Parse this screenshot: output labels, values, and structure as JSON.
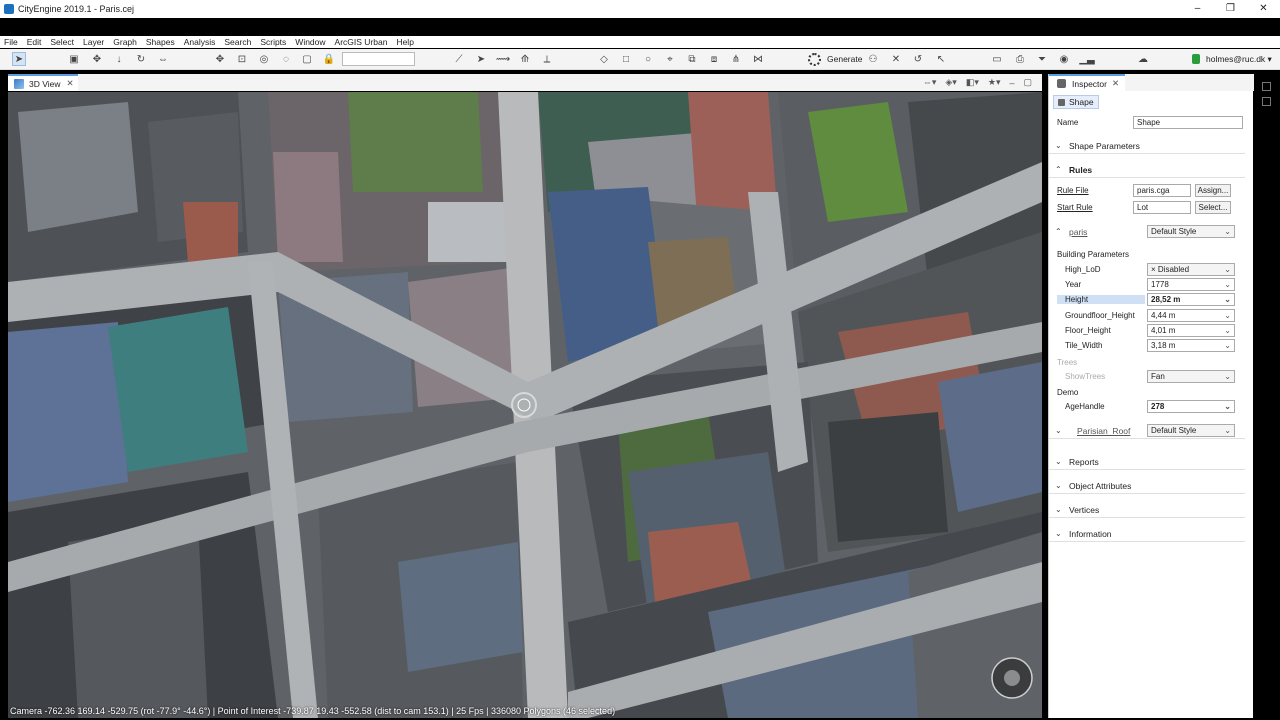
{
  "window": {
    "title": "CityEngine 2019.1 - Paris.cej",
    "controls": [
      "–",
      "❐",
      "✕"
    ]
  },
  "menu": [
    "File",
    "Edit",
    "Select",
    "Layer",
    "Graph",
    "Shapes",
    "Analysis",
    "Search",
    "Scripts",
    "Window",
    "ArcGIS Urban",
    "Help"
  ],
  "toolbar": {
    "generate_label": "Generate",
    "user_label": "holmes@ruc.dk ▾"
  },
  "view": {
    "tab_label": "3D View",
    "status": "Camera -762.36 169.14 -529.75 (rot -77.9° -44.6°) | Point of Interest -739.87 19.43 -552.58 (dist to cam 153.1) | 25 Fps | 336080 Polygons (46 selected)"
  },
  "inspector": {
    "tab_label": "Inspector",
    "shape_button": "Shape",
    "name_label": "Name",
    "name_value": "Shape",
    "shape_parameters": "Shape Parameters",
    "rules": "Rules",
    "rule_file_label": "Rule File",
    "rule_file_value": "paris.cga",
    "assign_button": "Assign...",
    "start_rule_label": "Start Rule",
    "start_rule_value": "Lot",
    "select_button": "Select...",
    "paris_label": "paris",
    "paris_style": "Default Style",
    "building_parameters": "Building Parameters",
    "params": [
      {
        "label": "High_LoD",
        "value": "× Disabled"
      },
      {
        "label": "Year",
        "value": "1778"
      },
      {
        "label": "Height",
        "value": "28,52 m"
      },
      {
        "label": "Groundfloor_Height",
        "value": "4,44 m"
      },
      {
        "label": "Floor_Height",
        "value": "4,01 m"
      },
      {
        "label": "Tile_Width",
        "value": "3,18 m"
      }
    ],
    "trees_label": "Trees",
    "show_trees_label": "ShowTrees",
    "show_trees_value": "Fan",
    "demo_label": "Demo",
    "age_handle_label": "AgeHandle",
    "age_handle_value": "278",
    "parisian_roof_label": "Parisian_Roof",
    "parisian_roof_style": "Default Style",
    "reports": "Reports",
    "object_attributes": "Object Attributes",
    "vertices": "Vertices",
    "information": "Information"
  }
}
